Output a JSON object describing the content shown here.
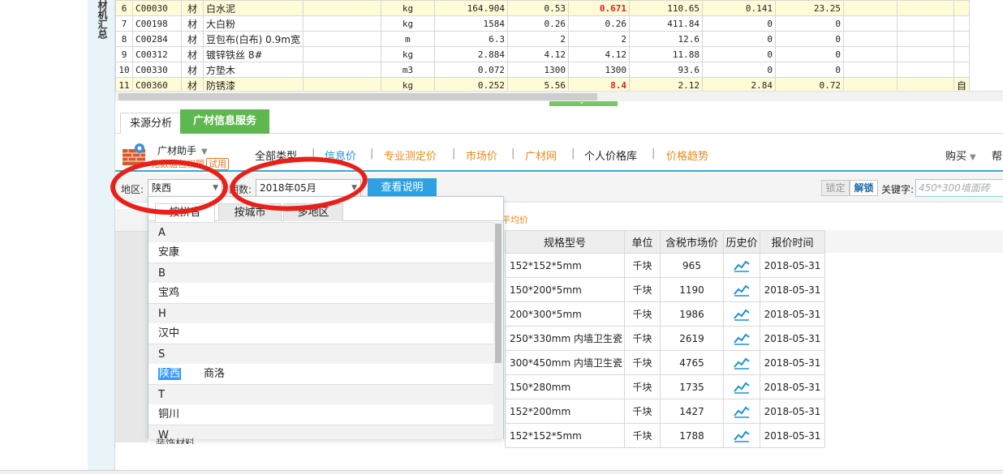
{
  "left_panel": {
    "vertical_text": "材机汇总"
  },
  "top_table": {
    "rows": [
      {
        "no": "6",
        "code": "C00030",
        "type": "材",
        "name": "白水泥",
        "spec": "",
        "unit": "kg",
        "qty": "164.904",
        "p1": "0.53",
        "p2": "0.671",
        "p3": "110.65",
        "p4": "0.141",
        "p5": "23.25",
        "p6": "",
        "p7": "",
        "extra": "",
        "highlight": true,
        "red": true
      },
      {
        "no": "7",
        "code": "C00198",
        "type": "材",
        "name": "大白粉",
        "spec": "",
        "unit": "kg",
        "qty": "1584",
        "p1": "0.26",
        "p2": "0.26",
        "p3": "411.84",
        "p4": "0",
        "p5": "0",
        "p6": "",
        "p7": "",
        "extra": "",
        "highlight": false,
        "red": false
      },
      {
        "no": "8",
        "code": "C00284",
        "type": "材",
        "name": "豆包布(白布) 0.9m宽",
        "spec": "",
        "unit": "m",
        "qty": "6.3",
        "p1": "2",
        "p2": "2",
        "p3": "12.6",
        "p4": "0",
        "p5": "0",
        "p6": "",
        "p7": "",
        "extra": "",
        "highlight": false,
        "red": false
      },
      {
        "no": "9",
        "code": "C00312",
        "type": "材",
        "name": "镀锌铁丝 8#",
        "spec": "",
        "unit": "kg",
        "qty": "2.884",
        "p1": "4.12",
        "p2": "4.12",
        "p3": "11.88",
        "p4": "0",
        "p5": "0",
        "p6": "",
        "p7": "",
        "extra": "",
        "highlight": false,
        "red": false
      },
      {
        "no": "10",
        "code": "C00330",
        "type": "材",
        "name": "方垫木",
        "spec": "",
        "unit": "m3",
        "qty": "0.072",
        "p1": "1300",
        "p2": "1300",
        "p3": "93.6",
        "p4": "0",
        "p5": "0",
        "p6": "",
        "p7": "",
        "extra": "",
        "highlight": false,
        "red": false
      },
      {
        "no": "11",
        "code": "C00360",
        "type": "材",
        "name": "防锈漆",
        "spec": "",
        "unit": "kg",
        "qty": "0.252",
        "p1": "5.56",
        "p2": "8.4",
        "p3": "2.12",
        "p4": "2.84",
        "p5": "0.72",
        "p6": "",
        "p7": "",
        "extra": "自",
        "highlight": true,
        "red": true
      }
    ]
  },
  "bottom_tabs": {
    "source": "来源分析",
    "info": "广材信息服务"
  },
  "toolbar": {
    "assistant": "广材助手",
    "no_auth": "无数据包权限",
    "trial": "试用",
    "nav": [
      "全部类型",
      "信息价",
      "专业测定价",
      "市场价",
      "广材网",
      "个人价格库",
      "价格趋势"
    ],
    "buy": "购买",
    "help": "帮"
  },
  "filter": {
    "region_label": "地区:",
    "region_value": "陕西",
    "period_label": "期数:",
    "period_value": "2018年05月",
    "help_button": "查看说明",
    "lock": "锁定",
    "unlock": "解锁",
    "keyword_label": "关键字:",
    "keyword_placeholder": "450*300墙面砖"
  },
  "hint_text": "平均价",
  "popup": {
    "tabs": [
      "按拼音",
      "按城市",
      "多地区"
    ],
    "groups": [
      {
        "letter": "A",
        "cities": [
          "安康"
        ]
      },
      {
        "letter": "B",
        "cities": [
          "宝鸡"
        ]
      },
      {
        "letter": "H",
        "cities": [
          "汉中"
        ]
      },
      {
        "letter": "S",
        "cities": [
          "陕西",
          "商洛"
        ]
      },
      {
        "letter": "T",
        "cities": [
          "铜川"
        ]
      },
      {
        "letter": "W",
        "cities": []
      }
    ],
    "selected_city": "陕西"
  },
  "grid": {
    "headers": [
      "规格型号",
      "单位",
      "含税市场价",
      "历史价",
      "报价时间"
    ],
    "rows": [
      {
        "spec": "152*152*5mm",
        "unit": "千块",
        "price": "965",
        "date": "2018-05-31"
      },
      {
        "spec": "150*200*5mm",
        "unit": "千块",
        "price": "1190",
        "date": "2018-05-31"
      },
      {
        "spec": "200*300*5mm",
        "unit": "千块",
        "price": "1986",
        "date": "2018-05-31"
      },
      {
        "spec": "250*330mm 内墙卫生瓷",
        "unit": "千块",
        "price": "2619",
        "date": "2018-05-31"
      },
      {
        "spec": "300*450mm 内墙卫生瓷",
        "unit": "千块",
        "price": "4765",
        "date": "2018-05-31"
      },
      {
        "spec": "150*280mm",
        "unit": "千块",
        "price": "1735",
        "date": "2018-05-31"
      },
      {
        "spec": "152*200mm",
        "unit": "千块",
        "price": "1427",
        "date": "2018-05-31"
      },
      {
        "spec": "152*152*5mm",
        "unit": "千块",
        "price": "1788",
        "date": "2018-05-31"
      }
    ]
  },
  "colors": {
    "accent_green": "#5fb84f",
    "accent_blue": "#2ea2e0",
    "nav_orange": "#e88a1c",
    "annotation_red": "#e8201a",
    "row_highlight": "#fffbd6"
  }
}
